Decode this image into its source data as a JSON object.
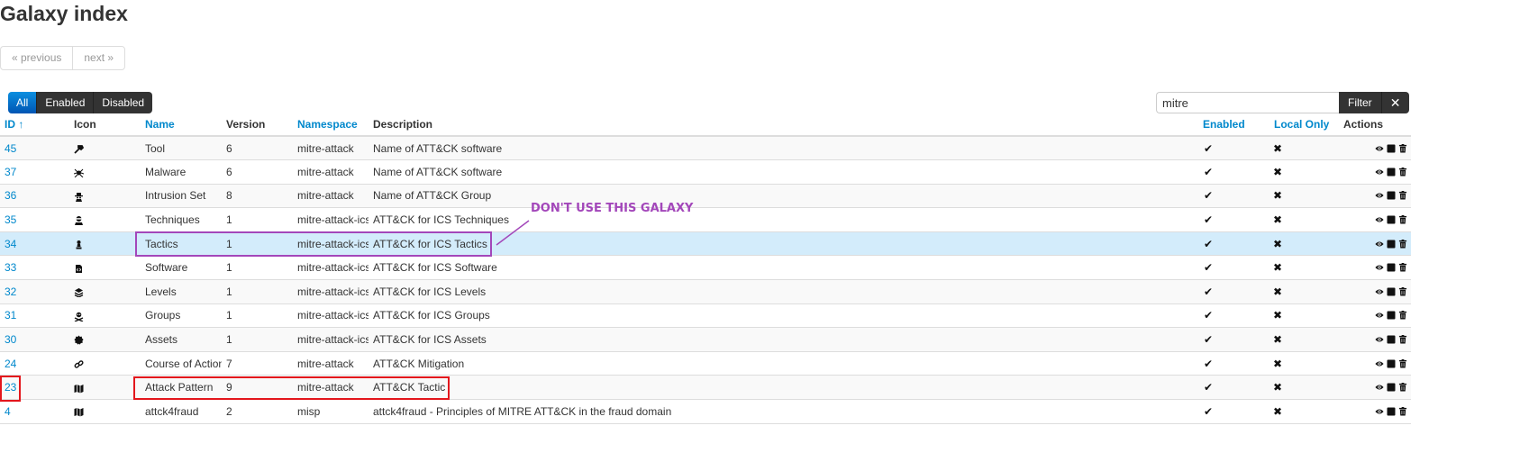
{
  "page": {
    "title": "Galaxy index"
  },
  "pagination": {
    "previous": "« previous",
    "next": "next »"
  },
  "filter_tabs": [
    {
      "label": "All",
      "active": true
    },
    {
      "label": "Enabled",
      "active": false
    },
    {
      "label": "Disabled",
      "active": false
    }
  ],
  "search": {
    "value": "mitre",
    "filter_label": "Filter",
    "clear_label": "✕"
  },
  "table": {
    "headers": {
      "id": "ID",
      "icon": "Icon",
      "name": "Name",
      "version": "Version",
      "namespace": "Namespace",
      "description": "Description",
      "enabled": "Enabled",
      "local_only": "Local Only",
      "actions": "Actions"
    },
    "sort_indicator": "↑",
    "rows": [
      {
        "id": "45",
        "icon": "hammer-icon",
        "name": "Tool",
        "version": "6",
        "namespace": "mitre-attack",
        "description": "Name of ATT&CK software",
        "enabled": true,
        "local_only": false
      },
      {
        "id": "37",
        "icon": "spider-icon",
        "name": "Malware",
        "version": "6",
        "namespace": "mitre-attack",
        "description": "Name of ATT&CK software",
        "enabled": true,
        "local_only": false
      },
      {
        "id": "36",
        "icon": "user-secret-icon",
        "name": "Intrusion Set",
        "version": "8",
        "namespace": "mitre-attack",
        "description": "Name of ATT&CK Group",
        "enabled": true,
        "local_only": false
      },
      {
        "id": "35",
        "icon": "user-ninja-icon",
        "name": "Techniques",
        "version": "1",
        "namespace": "mitre-attack-ics",
        "description": "ATT&CK for ICS Techniques",
        "enabled": true,
        "local_only": false
      },
      {
        "id": "34",
        "icon": "chess-pawn-icon",
        "name": "Tactics",
        "version": "1",
        "namespace": "mitre-attack-ics",
        "description": "ATT&CK for ICS Tactics",
        "enabled": true,
        "local_only": false,
        "highlight": true
      },
      {
        "id": "33",
        "icon": "file-code-icon",
        "name": "Software",
        "version": "1",
        "namespace": "mitre-attack-ics",
        "description": "ATT&CK for ICS Software",
        "enabled": true,
        "local_only": false
      },
      {
        "id": "32",
        "icon": "layer-group-icon",
        "name": "Levels",
        "version": "1",
        "namespace": "mitre-attack-ics",
        "description": "ATT&CK for ICS Levels",
        "enabled": true,
        "local_only": false
      },
      {
        "id": "31",
        "icon": "skull-crossbones-icon",
        "name": "Groups",
        "version": "1",
        "namespace": "mitre-attack-ics",
        "description": "ATT&CK for ICS Groups",
        "enabled": true,
        "local_only": false
      },
      {
        "id": "30",
        "icon": "certificate-icon",
        "name": "Assets",
        "version": "1",
        "namespace": "mitre-attack-ics",
        "description": "ATT&CK for ICS Assets",
        "enabled": true,
        "local_only": false
      },
      {
        "id": "24",
        "icon": "link-icon",
        "name": "Course of Action",
        "version": "7",
        "namespace": "mitre-attack",
        "description": "ATT&CK Mitigation",
        "enabled": true,
        "local_only": false
      },
      {
        "id": "23",
        "icon": "map-icon",
        "name": "Attack Pattern",
        "version": "9",
        "namespace": "mitre-attack",
        "description": "ATT&CK Tactic",
        "enabled": true,
        "local_only": false
      },
      {
        "id": "4",
        "icon": "map-icon",
        "name": "attck4fraud",
        "version": "2",
        "namespace": "misp",
        "description": "attck4fraud - Principles of MITRE ATT&CK in the fraud domain",
        "enabled": true,
        "local_only": false
      }
    ]
  },
  "annotation": {
    "text": "DON'T USE THIS GALAXY"
  },
  "colors": {
    "link": "#0088cc",
    "highlight_row": "#d3ecfb",
    "annotation_purple": "#a347ba",
    "annotation_red": "#e3161c"
  }
}
